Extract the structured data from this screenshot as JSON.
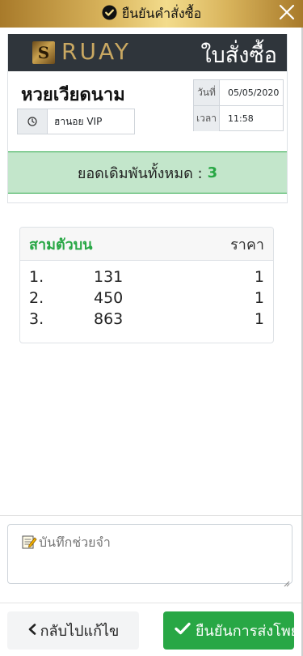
{
  "dialog": {
    "title": "ยืนยันคำสั่งซื้อ",
    "title_icon": "check-circle-icon",
    "close_icon": "close-icon"
  },
  "receipt": {
    "brand": "RUAY",
    "brand_mark": "S",
    "heading": "ใบสั่งซื้อ",
    "lottery_name": "หวยเวียดนาม",
    "round_icon": "clock-icon",
    "round_name": "ฮานอย VIP",
    "date_label": "วันที่",
    "date_value": "05/05/2020",
    "time_label": "เวลา",
    "time_value": "11:58",
    "total_label": "ยอดเดิมพันทั้งหมด :",
    "total_count": "3"
  },
  "bets": {
    "type_label": "สามตัวบน",
    "price_label": "ราคา",
    "rows": [
      {
        "index": "1.",
        "number": "131",
        "amount": "1"
      },
      {
        "index": "2.",
        "number": "450",
        "amount": "1"
      },
      {
        "index": "3.",
        "number": "863",
        "amount": "1"
      }
    ]
  },
  "memo": {
    "icon": "memo-icon",
    "placeholder": "บันทึกช่วยจำ"
  },
  "actions": {
    "back_icon": "chevron-left-icon",
    "back_label": "กลับไปแก้ไข",
    "confirm_icon": "check-icon",
    "confirm_label": "ยืนยันการส่งโพย"
  },
  "colors": {
    "accent_green": "#28a745",
    "total_bg": "#c3e6cb",
    "header_dark": "#2f353b",
    "gold": "#c9a862"
  }
}
